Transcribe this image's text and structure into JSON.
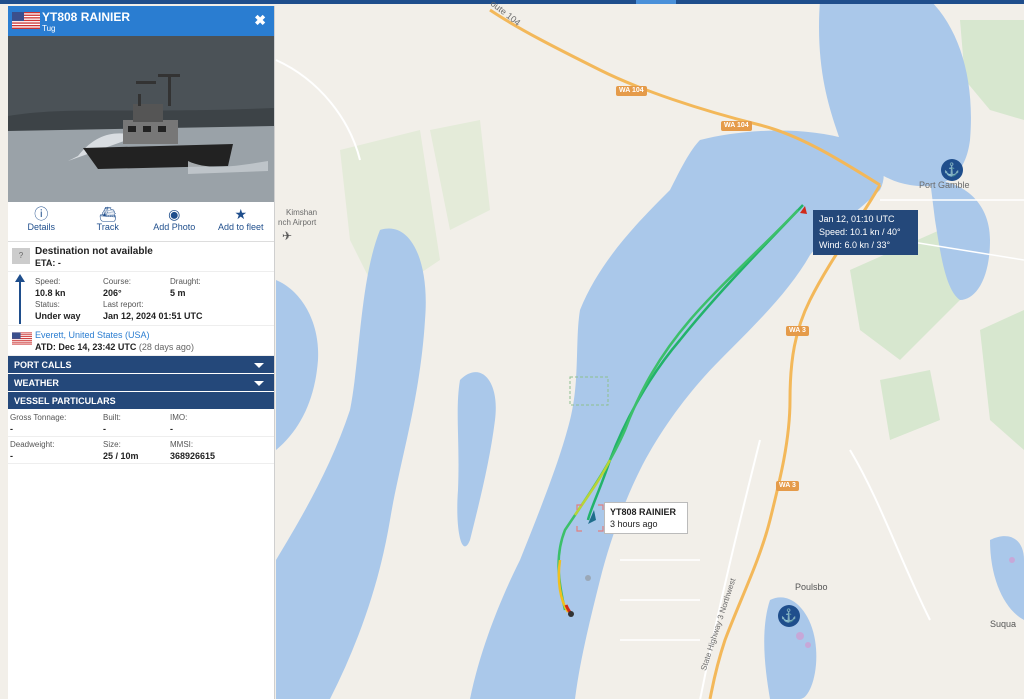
{
  "vessel": {
    "name": "YT808 RAINIER",
    "type": "Tug",
    "close_glyph": "✖"
  },
  "actions": [
    {
      "label": "Details",
      "icon": "info-icon"
    },
    {
      "label": "Track",
      "icon": "ship-icon"
    },
    {
      "label": "Add Photo",
      "icon": "camera-icon"
    },
    {
      "label": "Add to fleet",
      "icon": "star-icon"
    }
  ],
  "destination": {
    "badge": "?",
    "text": "Destination not available",
    "eta": "ETA: -"
  },
  "stats": {
    "speed_label": "Speed:",
    "speed": "10.8 kn",
    "course_label": "Course:",
    "course": "206°",
    "draught_label": "Draught:",
    "draught": "5 m",
    "status_label": "Status:",
    "status": "Under way",
    "report_label": "Last report:",
    "report": "Jan 12, 2024 01:51 UTC"
  },
  "departure": {
    "port": "Everett, United States (USA)",
    "atd_label": "ATD:",
    "atd": "Dec 14, 23:42 UTC",
    "ago": "(28 days ago)"
  },
  "sections": {
    "port_calls": "PORT CALLS",
    "weather": "WEATHER",
    "particulars": "VESSEL PARTICULARS"
  },
  "particulars": {
    "gt_label": "Gross Tonnage:",
    "gt": "-",
    "built_label": "Built:",
    "built": "-",
    "imo_label": "IMO:",
    "imo": "-",
    "dwt_label": "Deadweight:",
    "dwt": "-",
    "size_label": "Size:",
    "size": "25 / 10m",
    "mmsi_label": "MMSI:",
    "mmsi": "368926615"
  },
  "map": {
    "labels": {
      "route104": "oute 104",
      "port_gamble": "Port Gamble",
      "airport1": "Kimshan",
      "airport2": "nch Airport",
      "poulsbo": "Poulsbo",
      "suqua": "Suqua",
      "hwy3nw": "State Highway 3 Northwest"
    },
    "shields": {
      "wa104a": "WA 104",
      "wa104b": "WA 104",
      "wa3a": "WA 3",
      "wa3b": "WA 3"
    },
    "tooltip_position": {
      "time": "Jan 12, 01:10 UTC",
      "speed": "Speed: 10.1 kn / 40°",
      "wind": "Wind: 6.0 kn / 33°"
    },
    "tooltip_vessel": {
      "name": "YT808 RAINIER",
      "age": "3 hours ago"
    }
  },
  "colors": {
    "header_blue": "#2a7dd1",
    "section_navy": "#24487a",
    "water": "#aac8ea",
    "land": "#f2efe9",
    "track_green": "#2fbf6b"
  }
}
